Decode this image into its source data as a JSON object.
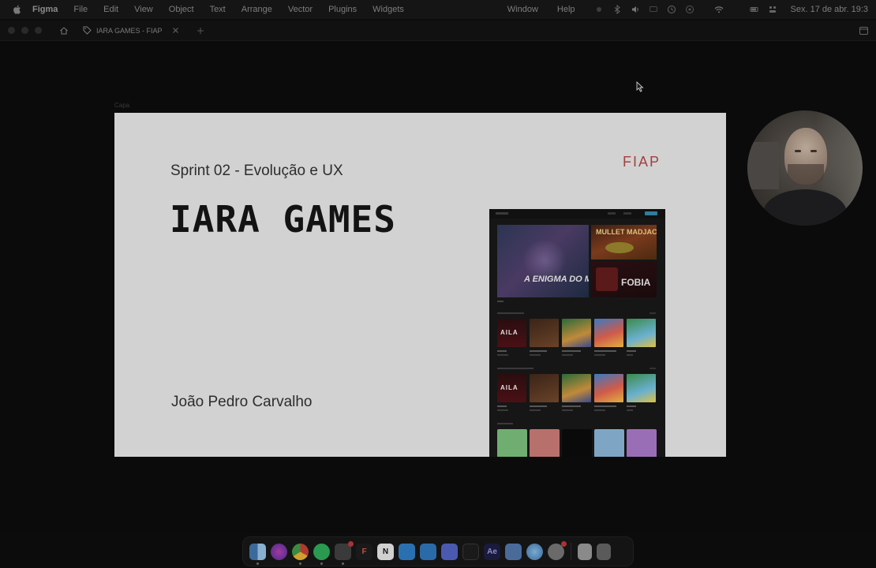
{
  "menubar": {
    "app": "Figma",
    "menus": [
      "File",
      "Edit",
      "View",
      "Object",
      "Text",
      "Arrange",
      "Vector",
      "Plugins",
      "Widgets"
    ],
    "right_menus": [
      "Window",
      "Help"
    ],
    "clock": "Sex. 17 de abr. 19:3"
  },
  "tabbar": {
    "file_tab": "IARA GAMES - FIAP"
  },
  "canvas": {
    "frame_label": "Capa"
  },
  "slide": {
    "sprint": "Sprint 02 - Evolução e UX",
    "title": "IARA GAMES",
    "author": "João Pedro Carvalho",
    "brand": "FIAP"
  },
  "mockup": {
    "hero_main_text": "A ENIGMA DO MEDO",
    "hero_a_text": "MULLET MADJACK",
    "hero_b_text": "FOBIA",
    "card_aila": "AILA"
  },
  "dock": {
    "figma_letter": "F",
    "notion_letter": "N",
    "ae_label": "Ae"
  },
  "colors": {
    "accent_brand": "#a34040",
    "canvas": "#0b0b0b",
    "slide_bg": "#d2d2d2"
  }
}
